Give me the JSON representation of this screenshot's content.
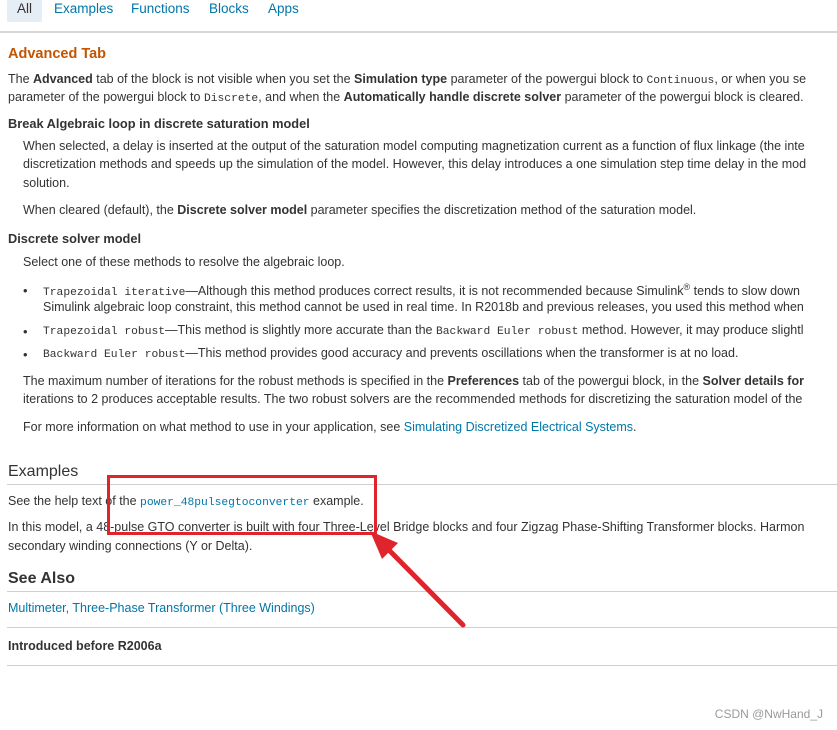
{
  "tabs": [
    {
      "label": "All"
    },
    {
      "label": "Examples"
    },
    {
      "label": "Functions"
    },
    {
      "label": "Blocks"
    },
    {
      "label": "Apps"
    }
  ],
  "advanced": {
    "title": "Advanced Tab",
    "p1a_1": "The ",
    "p1a_b1": "Advanced",
    "p1a_2": " tab of the block is not visible when you set the ",
    "p1a_b2": "Simulation type",
    "p1a_3": " parameter of the powergui block to ",
    "p1a_m1": "Continuous",
    "p1a_4": ", or when you se",
    "p1b_1": "parameter of the powergui block to ",
    "p1b_m1": "Discrete",
    "p1b_2": ", and when the ",
    "p1b_b1": "Automatically handle discrete solver",
    "p1b_3": " parameter of the powergui block is cleared."
  },
  "break_loop": {
    "title": "Break Algebraic loop in discrete saturation model",
    "l1": "When selected, a delay is inserted at the output of the saturation model computing magnetization current as a function of flux linkage (the inte",
    "l2": "discretization methods and speeds up the simulation of the model. However, this delay introduces a one simulation step time delay in the mod",
    "l3": "solution.",
    "c1": "When cleared (default), the ",
    "c_b": "Discrete solver model",
    "c2": " parameter specifies the discretization method of the saturation model."
  },
  "solver": {
    "title": "Discrete solver model",
    "intro": "Select one of these methods to resolve the algebraic loop.",
    "b1_m": "Trapezoidal iterative",
    "b1_t": "—Although this method produces correct results, it is not recommended because Simulink",
    "b1_sup": "®",
    "b1_t2": " tends to slow down",
    "b1_l2": "Simulink algebraic loop constraint, this method cannot be used in real time. In R2018b and previous releases, you used this method when",
    "b2_m": "Trapezoidal robust",
    "b2_t": "—This method is slightly more accurate than the ",
    "b2_m2": "Backward Euler robust",
    "b2_t2": " method. However, it may produce slightl",
    "b3_m": "Backward Euler robust",
    "b3_t": "—This method provides good accuracy and prevents oscillations when the transformer is at no load.",
    "max1_a": "The maximum number of iterations for the robust methods is specified in the ",
    "max1_b1": "Preferences",
    "max1_c": " tab of the powergui block, in the ",
    "max1_b2": "Solver details for",
    "max2": "iterations to 2 produces acceptable results. The two robust solvers are the recommended methods for discretizing the saturation model of the",
    "more_a": "For more information on what method to use in your application, see ",
    "more_link": "Simulating Discretized Electrical Systems",
    "more_b": "."
  },
  "examples": {
    "title": "Examples",
    "l1_a": "See the help text of the ",
    "l1_link": "power_48pulsegtoconverter",
    "l1_b": " example.",
    "l2": "In this model, a 48-pulse GTO converter is built with four Three-Level Bridge blocks and four Zigzag Phase-Shifting Transformer blocks. Harmon",
    "l3": "secondary winding connections (Y or Delta)."
  },
  "see_also": {
    "title": "See Also",
    "link1": "Multimeter",
    "sep": ", ",
    "link2": "Three-Phase Transformer (Three Windings)"
  },
  "introduced": "Introduced before R2006a",
  "watermark": "CSDN @NwHand_J",
  "annotation_color": "#e0242b"
}
